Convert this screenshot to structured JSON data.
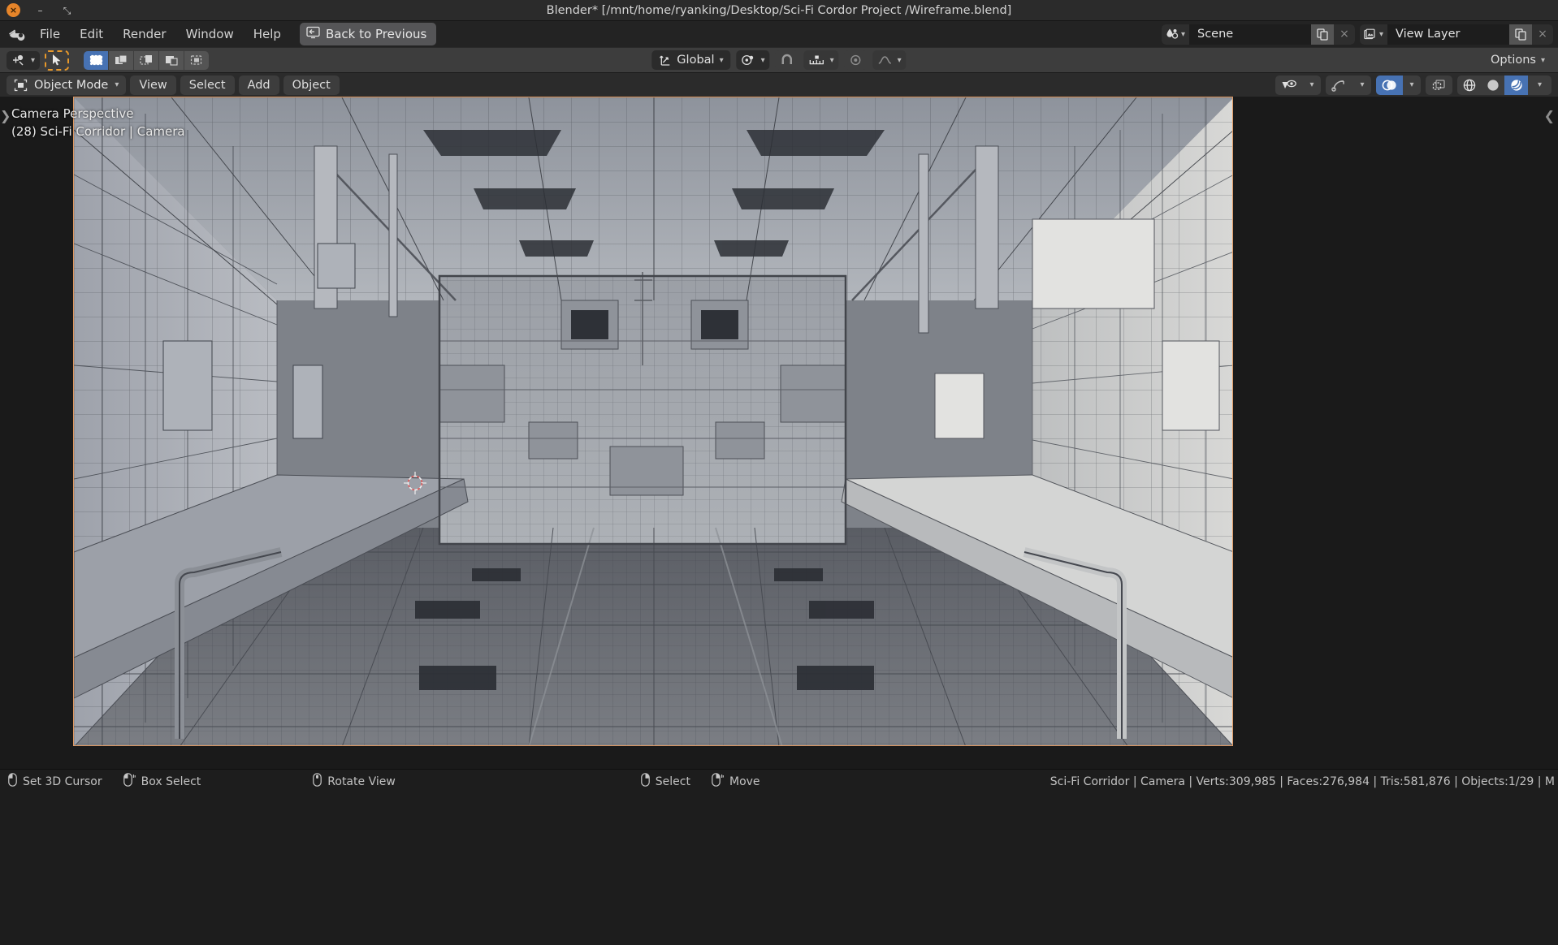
{
  "window": {
    "title": "Blender* [/mnt/home/ryanking/Desktop/Sci-Fi Cordor Project /Wireframe.blend]",
    "close_glyph": "×",
    "minimize_glyph": "–",
    "maximize_glyph": "⤡"
  },
  "topbar": {
    "logo_name": "blender-logo",
    "menus": [
      "File",
      "Edit",
      "Render",
      "Window",
      "Help"
    ],
    "back_to_previous": "Back to Previous",
    "scene": {
      "label": "Scene",
      "icon": "scene-icon",
      "new_icon": "duplicate-icon",
      "close_icon": "×"
    },
    "view_layer": {
      "label": "View Layer",
      "icon": "view-layer-icon",
      "new_icon": "duplicate-icon",
      "close_icon": "×"
    }
  },
  "toolheader": {
    "cursor_tool": "cursor-tool-icon",
    "tweak_tool": "tweak-select-icon",
    "select_modes": [
      "set-select-icon",
      "extend-select-icon",
      "subtract-select-icon",
      "invert-select-icon",
      "intersect-select-icon"
    ],
    "transform_orientation": {
      "label": "Global",
      "icon": "orientation-axes-icon"
    },
    "pivot_point": {
      "icon": "pivot-point-icon"
    },
    "snap_magnet": {
      "icon": "magnet-icon"
    },
    "snap_target": {
      "icon": "snap-increment-icon"
    },
    "proportional_edit": {
      "icon": "proportional-edit-icon"
    },
    "proportional_falloff": {
      "icon": "falloff-curve-icon"
    },
    "options_label": "Options"
  },
  "viewport_header": {
    "mode": {
      "label": "Object Mode",
      "icon": "object-mode-icon"
    },
    "menus": [
      "View",
      "Select",
      "Add",
      "Object"
    ],
    "visibility": {
      "icon": "show-hide-icon"
    },
    "gizmo": {
      "icon": "gizmo-icon"
    },
    "overlays": {
      "icon": "overlays-icon"
    },
    "xray": {
      "icon": "xray-icon"
    },
    "shading": [
      "wireframe-shading-icon",
      "solid-shading-icon",
      "material-shading-icon"
    ],
    "shading_active_index": 2
  },
  "viewport": {
    "overlay_line1": "Camera Perspective",
    "overlay_line2": "(28) Sci-Fi Corridor | Camera",
    "left_panel_toggle": "❯",
    "right_panel_toggle": "❮",
    "cursor_3d_name": "3d-cursor",
    "scene_description": "Grayscale wireframe render of a sci-fi spaceship corridor seen in camera perspective"
  },
  "statusbar": {
    "keymap": [
      {
        "mouse": "left-mouse-icon",
        "label": "Set 3D Cursor"
      },
      {
        "mouse": "left-drag-mouse-icon",
        "label": "Box Select"
      },
      {
        "mouse": "middle-mouse-icon",
        "label": "Rotate View"
      },
      {
        "mouse": "right-mouse-icon",
        "label": "Select"
      },
      {
        "mouse": "right-drag-mouse-icon",
        "label": "Move"
      }
    ],
    "stats": "Sci-Fi Corridor | Camera | Verts:309,985 | Faces:276,984 | Tris:581,876 | Objects:1/29 | M"
  },
  "colors": {
    "accent_blue": "#4772b3",
    "accent_orange": "#e8992b",
    "camera_border": "#e09a63",
    "cursor_red": "#e05a5a",
    "bg_dark": "#1d1d1d",
    "bg_header": "#2b2b2b",
    "bg_tool": "#3d3d3d"
  }
}
